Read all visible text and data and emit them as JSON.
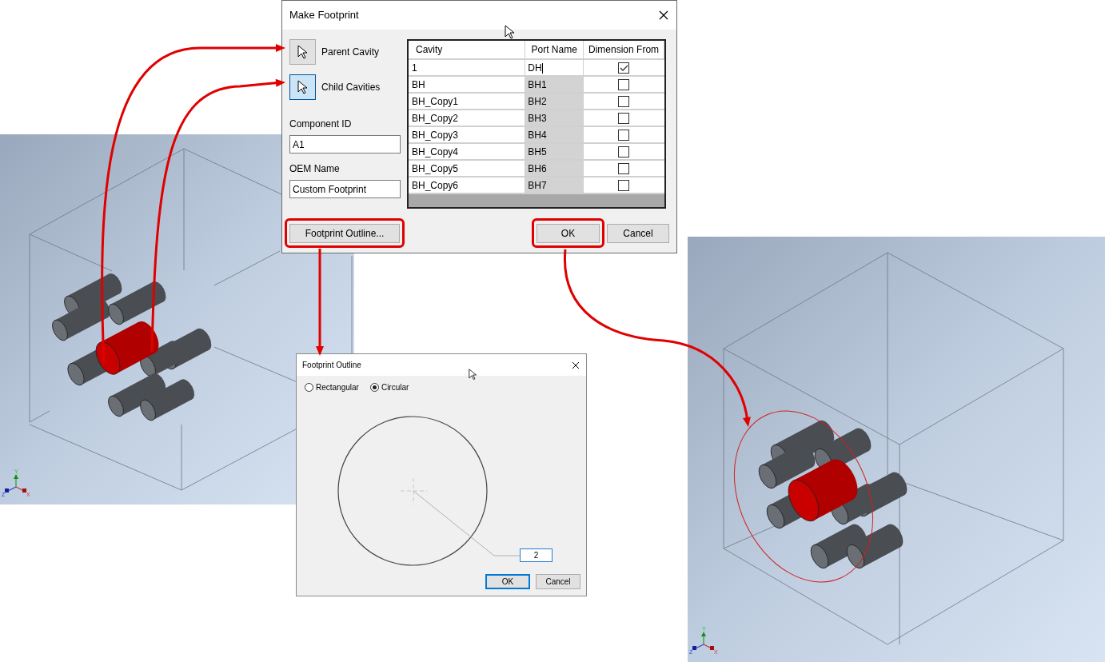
{
  "make_footprint": {
    "title": "Make Footprint",
    "pick_buttons": [
      {
        "label": "Parent Cavity",
        "selected": false
      },
      {
        "label": "Child Cavities",
        "selected": true
      }
    ],
    "fields": [
      {
        "label": "Component ID",
        "value": "A1"
      },
      {
        "label": "OEM Name",
        "value": "Custom Footprint"
      }
    ],
    "table": {
      "columns": [
        "Cavity",
        "Port Name",
        "Dimension From"
      ],
      "rows": [
        {
          "cavity": "1",
          "port_name": "DH",
          "editing": true,
          "checked": true
        },
        {
          "cavity": "BH",
          "port_name": "BH1",
          "editing": false,
          "checked": false
        },
        {
          "cavity": "BH_Copy1",
          "port_name": "BH2",
          "editing": false,
          "checked": false
        },
        {
          "cavity": "BH_Copy2",
          "port_name": "BH3",
          "editing": false,
          "checked": false
        },
        {
          "cavity": "BH_Copy3",
          "port_name": "BH4",
          "editing": false,
          "checked": false
        },
        {
          "cavity": "BH_Copy4",
          "port_name": "BH5",
          "editing": false,
          "checked": false
        },
        {
          "cavity": "BH_Copy5",
          "port_name": "BH6",
          "editing": false,
          "checked": false
        },
        {
          "cavity": "BH_Copy6",
          "port_name": "BH7",
          "editing": false,
          "checked": false
        }
      ]
    },
    "buttons": [
      {
        "label": "Footprint Outline...",
        "highlighted": true
      },
      {
        "label": "OK",
        "highlighted": true
      },
      {
        "label": "Cancel",
        "highlighted": false
      }
    ]
  },
  "footprint_outline": {
    "title": "Footprint Outline",
    "options": [
      {
        "label": "Rectangular",
        "selected": false
      },
      {
        "label": "Circular",
        "selected": true
      }
    ],
    "radius": "2",
    "buttons": [
      {
        "label": "OK",
        "default": true
      },
      {
        "label": "Cancel",
        "default": false
      }
    ]
  },
  "viewports": [
    {
      "axes": [
        "Y",
        "Z",
        "X"
      ],
      "footprint_shown": false
    },
    {
      "axes": [
        "Y",
        "Z",
        "X"
      ],
      "footprint_shown": true
    }
  ]
}
